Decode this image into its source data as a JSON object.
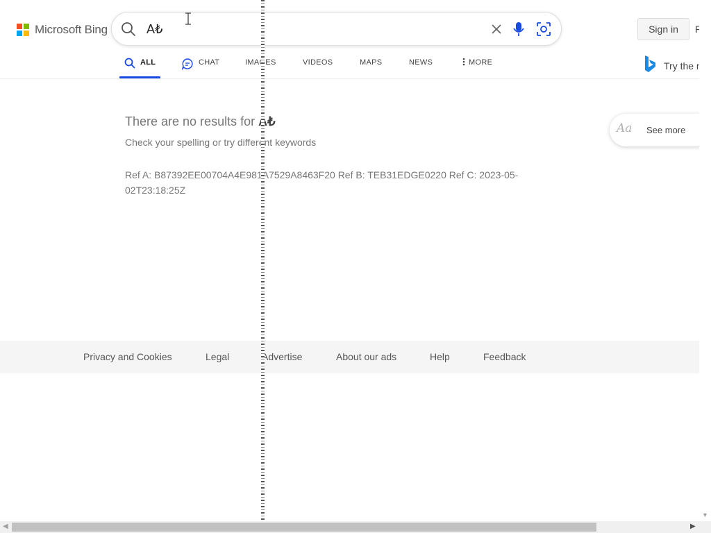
{
  "brand": {
    "name": "Microsoft Bing",
    "logo_colors": [
      "#f25022",
      "#7fba00",
      "#00a4ef",
      "#ffb900"
    ]
  },
  "search": {
    "query": "A₺",
    "icons": [
      "search-icon",
      "close-icon",
      "microphone-icon",
      "visual-search-icon"
    ]
  },
  "header": {
    "sign_in_label": "Sign in",
    "rewards_label": "R"
  },
  "tabs": [
    {
      "label": "ALL",
      "icon": "search-icon",
      "active": true
    },
    {
      "label": "CHAT",
      "icon": "chat-icon",
      "active": false
    },
    {
      "label": "IMAGES",
      "active": false
    },
    {
      "label": "VIDEOS",
      "active": false
    },
    {
      "label": "MAPS",
      "active": false
    },
    {
      "label": "NEWS",
      "active": false
    },
    {
      "label": "MORE",
      "icon": "more-vertical-icon",
      "active": false
    }
  ],
  "copilot": {
    "label": "Try the n",
    "icon": "bing-copilot-icon"
  },
  "results": {
    "message_prefix": "There are no results for",
    "query": "A₺",
    "hint": "Check your spelling or try different keywords",
    "refs": "Ref A: B87392EE00704A4E981A7529A8463F20 Ref B: TEB31EDGE0220 Ref C: 2023-05-02T23:18:25Z"
  },
  "side_panel": {
    "see_more_label": "See more",
    "icon_text": "Aa"
  },
  "footer": {
    "links": [
      "Privacy and Cookies",
      "Legal",
      "Advertise",
      "About our ads",
      "Help",
      "Feedback"
    ]
  },
  "colors": {
    "accent": "#174ae4",
    "muted_text": "#767676",
    "footer_bg": "#f5f5f5"
  }
}
